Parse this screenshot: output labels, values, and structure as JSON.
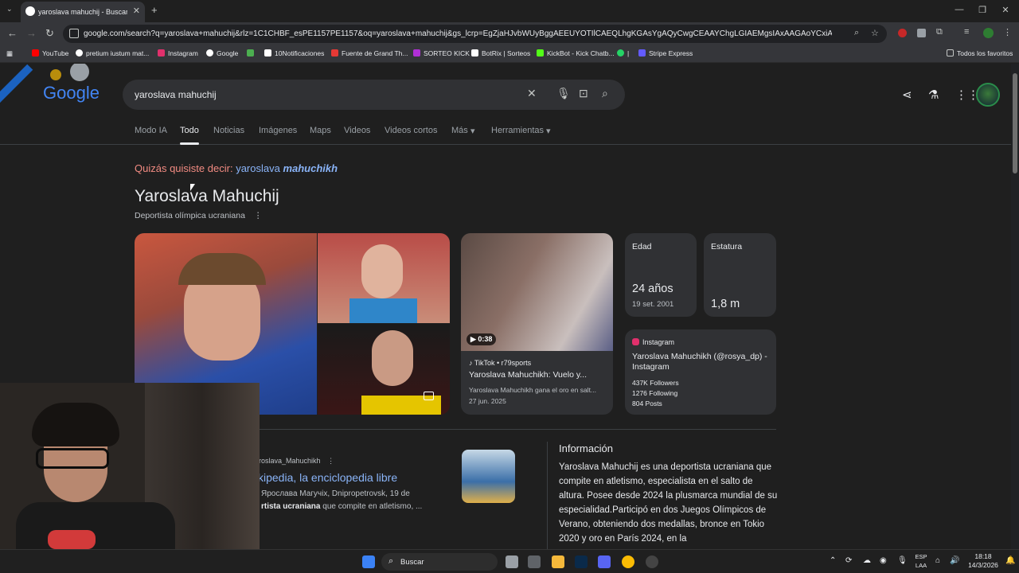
{
  "browser": {
    "tab_title": "yaroslava mahuchij - Buscar con Google",
    "url": "google.com/search?q=yaroslava+mahuchij&rlz=1C1CHBF_esPE1157PE1157&oq=yaroslava+mahuchij&gs_lcrp=EgZjaHJvbWUyBggAEEUYOTIlCAEQLhgKGAsYgAQyCwgCEAAYChgLGIAEMgsIAxAAGAoYCxiABDILCAQQABgKGAsYgAQy..."
  },
  "bookmarks": [
    {
      "label": "YouTube",
      "color": "#ff0000"
    },
    {
      "label": "pretium iustum mat...",
      "color": "#ffffff"
    },
    {
      "label": "Instagram",
      "color": "#e1306c"
    },
    {
      "label": "Google",
      "color": "#ffffff"
    },
    {
      "label": "",
      "color": "#4caf50"
    },
    {
      "label": "10Notificaciones",
      "color": "#ffffff"
    },
    {
      "label": "Fuente de Grand Th...",
      "color": "#e53935"
    },
    {
      "label": "SORTEO KICK",
      "color": "#b02fd6"
    },
    {
      "label": "BotRix | Sorteos",
      "color": "#ffffff"
    },
    {
      "label": "KickBot - Kick Chatb...",
      "color": "#53fc18"
    },
    {
      "label": "|",
      "color": "#25d366"
    },
    {
      "label": "Stripe Express",
      "color": "#635bff"
    }
  ],
  "bookmarks_other": "Todos los favoritos",
  "search": {
    "query": "yaroslava mahuchij",
    "logo_text": "Google"
  },
  "tabs": [
    "Modo IA",
    "Todo",
    "Noticias",
    "Imágenes",
    "Maps",
    "Videos",
    "Videos cortos",
    "Más",
    "Herramientas"
  ],
  "did_you_mean": {
    "prefix": "Quizás quisiste decir:",
    "plain": "yaroslava",
    "bold": "mahuchikh"
  },
  "knowledge_panel": {
    "title": "Yaroslava Mahuchij",
    "subtitle": "Deportista olímpica ucraniana",
    "video": {
      "duration": "0:38",
      "source": "TikTok • r79sports",
      "title": "Yaroslava Mahuchikh: Vuelo y...",
      "desc": "Yaroslava Mahuchikh gana el oro en salt...",
      "date": "27 jun. 2025"
    },
    "age": {
      "label": "Edad",
      "value": "24 años",
      "detail": "19 set. 2001"
    },
    "height": {
      "label": "Estatura",
      "value": "1,8 m"
    },
    "instagram": {
      "source": "Instagram",
      "title": "Yaroslava Mahuchikh (@rosya_dp) - Instagram",
      "followers": "437K Followers",
      "following": "1276 Following",
      "posts": "804 Posts"
    }
  },
  "wiki": {
    "source": "aroslava_Mahuchikh",
    "title": "kipedia, la enciclopedia libre",
    "snippet_1": "Ярослава Магучіх, Dnipropetrovsk, 19 de",
    "snippet_bold": "rtista ucraniana",
    "snippet_2": "que compite en atletismo, ..."
  },
  "info": {
    "title": "Información",
    "body": "Yaroslava Mahuchij es una deportista ucraniana que compite en atletismo, especialista en el salto de altura. Posee desde 2024 la plusmarca mundial de su especialidad.Participó en dos Juegos Olímpicos de Verano, obteniendo dos medallas, bronce en Tokio 2020 y oro en París 2024, en la"
  },
  "taskbar": {
    "search_label": "Buscar",
    "lang_1": "ESP",
    "lang_2": "LAA",
    "time": "18:18",
    "date": "14/3/2026"
  }
}
